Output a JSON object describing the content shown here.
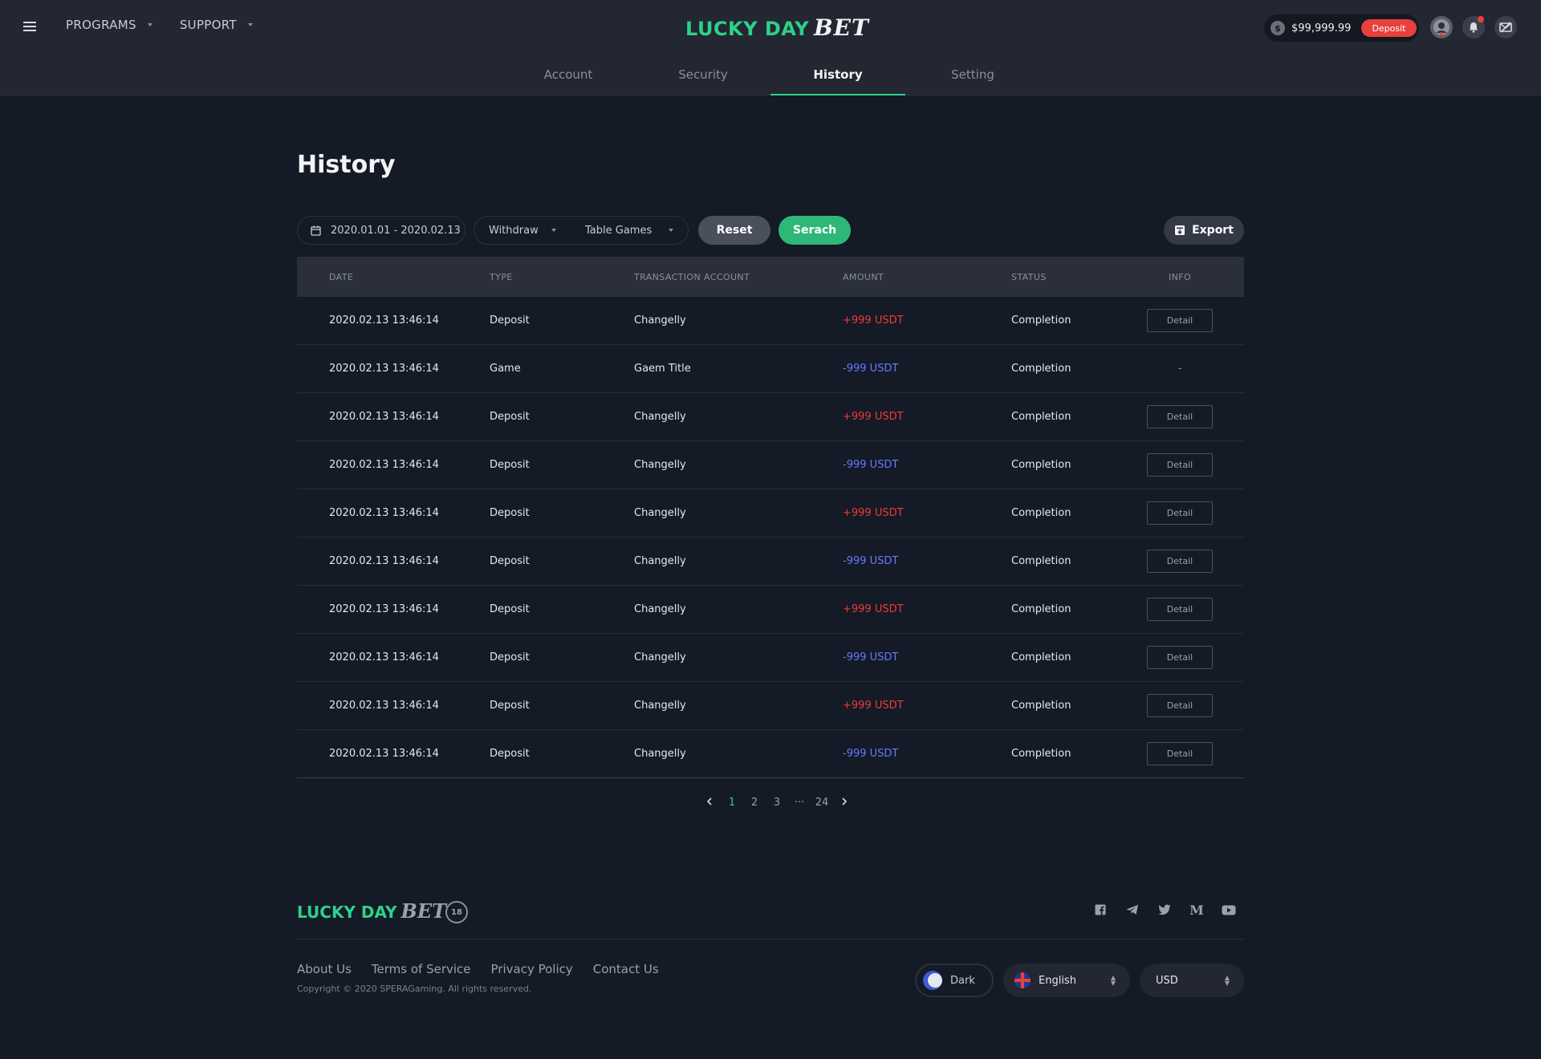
{
  "header": {
    "nav": [
      {
        "label": "PROGRAMS"
      },
      {
        "label": "SUPPORT"
      }
    ],
    "logo": {
      "word1": "LUCKY DAY",
      "word2": "BET"
    },
    "wallet": {
      "currency_symbol": "$",
      "balance": "$99,999.99",
      "deposit_label": "Deposit"
    },
    "colors": {
      "brand": "#2fd08a",
      "deposit": "#e8403c"
    }
  },
  "tabs": [
    {
      "label": "Account",
      "active": false
    },
    {
      "label": "Security",
      "active": false
    },
    {
      "label": "History",
      "active": true
    },
    {
      "label": "Setting",
      "active": false
    }
  ],
  "page": {
    "title": "History"
  },
  "filters": {
    "date_range": "2020.01.01 - 2020.02.13",
    "type_select": "Withdraw",
    "category_select": "Table Games",
    "reset_label": "Reset",
    "search_label": "Serach",
    "export_label": "Export"
  },
  "table": {
    "columns": [
      "DATE",
      "TYPE",
      "TRANSACTION ACCOUNT",
      "AMOUNT",
      "STATUS",
      "INFO"
    ],
    "detail_label": "Detail",
    "rows": [
      {
        "date": "2020.02.13 13:46:14",
        "type": "Deposit",
        "account": "Changelly",
        "amount": "+999 USDT",
        "status": "Completion",
        "info": "Detail"
      },
      {
        "date": "2020.02.13 13:46:14",
        "type": "Game",
        "account": "Gaem Title",
        "amount": "-999 USDT",
        "status": "Completion",
        "info": "-"
      },
      {
        "date": "2020.02.13 13:46:14",
        "type": "Deposit",
        "account": "Changelly",
        "amount": "+999 USDT",
        "status": "Completion",
        "info": "Detail"
      },
      {
        "date": "2020.02.13 13:46:14",
        "type": "Deposit",
        "account": "Changelly",
        "amount": "-999 USDT",
        "status": "Completion",
        "info": "Detail"
      },
      {
        "date": "2020.02.13 13:46:14",
        "type": "Deposit",
        "account": "Changelly",
        "amount": "+999 USDT",
        "status": "Completion",
        "info": "Detail"
      },
      {
        "date": "2020.02.13 13:46:14",
        "type": "Deposit",
        "account": "Changelly",
        "amount": "-999 USDT",
        "status": "Completion",
        "info": "Detail"
      },
      {
        "date": "2020.02.13 13:46:14",
        "type": "Deposit",
        "account": "Changelly",
        "amount": "+999 USDT",
        "status": "Completion",
        "info": "Detail"
      },
      {
        "date": "2020.02.13 13:46:14",
        "type": "Deposit",
        "account": "Changelly",
        "amount": "-999 USDT",
        "status": "Completion",
        "info": "Detail"
      },
      {
        "date": "2020.02.13 13:46:14",
        "type": "Deposit",
        "account": "Changelly",
        "amount": "+999 USDT",
        "status": "Completion",
        "info": "Detail"
      },
      {
        "date": "2020.02.13 13:46:14",
        "type": "Deposit",
        "account": "Changelly",
        "amount": "-999 USDT",
        "status": "Completion",
        "info": "Detail"
      }
    ],
    "colors": {
      "positive": "#ee3b3b",
      "negative": "#6878ff"
    }
  },
  "pagination": {
    "pages": [
      "1",
      "2",
      "3",
      "···",
      "24"
    ],
    "current": "1"
  },
  "footer": {
    "logo": {
      "word1": "LUCKY DAY",
      "word2": "BET"
    },
    "age_badge": "18",
    "socials": [
      "facebook-icon",
      "telegram-icon",
      "twitter-icon",
      "medium-icon",
      "youtube-icon"
    ],
    "links": [
      "About Us",
      "Terms of Service",
      "Privacy Policy",
      "Contact Us"
    ],
    "copyright": "Copyright © 2020 SPERAGaming. All rights reserved.",
    "theme_label": "Dark",
    "language": "English",
    "currency": "USD"
  }
}
